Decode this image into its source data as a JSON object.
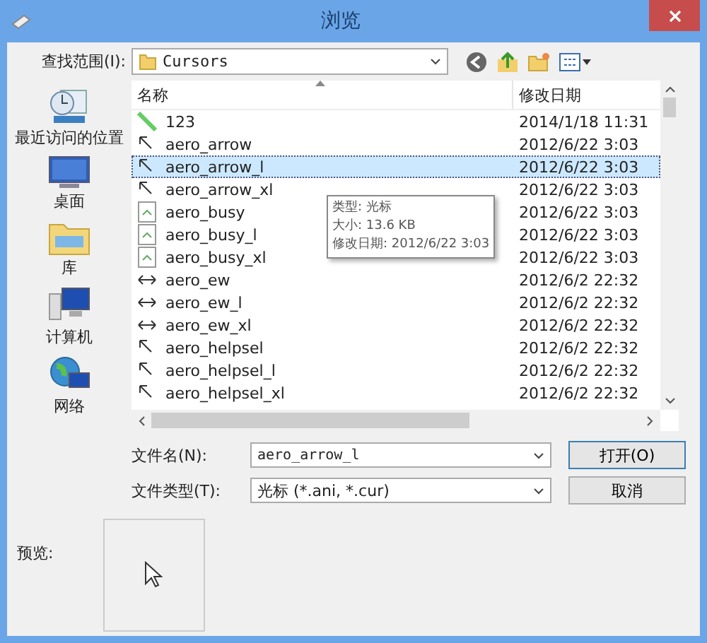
{
  "window": {
    "title": "浏览"
  },
  "location": {
    "label": "查找范围(I):",
    "value": "Cursors"
  },
  "sidebar": {
    "items": [
      {
        "label": "最近访问的位置",
        "kind": "recent"
      },
      {
        "label": "桌面",
        "kind": "desktop"
      },
      {
        "label": "库",
        "kind": "library"
      },
      {
        "label": "计算机",
        "kind": "computer"
      },
      {
        "label": "网络",
        "kind": "network"
      }
    ]
  },
  "table": {
    "columns": [
      "名称",
      "修改日期"
    ],
    "rows": [
      {
        "name": "123",
        "date": "2014/1/18 11:31",
        "kind": "green",
        "selected": false
      },
      {
        "name": "aero_arrow",
        "date": "2012/6/22 3:03",
        "kind": "arrow",
        "selected": false
      },
      {
        "name": "aero_arrow_l",
        "date": "2012/6/22 3:03",
        "kind": "arrow",
        "selected": true
      },
      {
        "name": "aero_arrow_xl",
        "date": "2012/6/22 3:03",
        "kind": "arrow",
        "selected": false
      },
      {
        "name": "aero_busy",
        "date": "2012/6/22 3:03",
        "kind": "doc",
        "selected": false
      },
      {
        "name": "aero_busy_l",
        "date": "2012/6/22 3:03",
        "kind": "doc",
        "selected": false
      },
      {
        "name": "aero_busy_xl",
        "date": "2012/6/22 3:03",
        "kind": "doc",
        "selected": false
      },
      {
        "name": "aero_ew",
        "date": "2012/6/2 22:32",
        "kind": "ew",
        "selected": false
      },
      {
        "name": "aero_ew_l",
        "date": "2012/6/2 22:32",
        "kind": "ew",
        "selected": false
      },
      {
        "name": "aero_ew_xl",
        "date": "2012/6/2 22:32",
        "kind": "ew",
        "selected": false
      },
      {
        "name": "aero_helpsel",
        "date": "2012/6/2 22:32",
        "kind": "arrow",
        "selected": false
      },
      {
        "name": "aero_helpsel_l",
        "date": "2012/6/2 22:32",
        "kind": "arrow",
        "selected": false
      },
      {
        "name": "aero_helpsel_xl",
        "date": "2012/6/2 22:32",
        "kind": "arrow",
        "selected": false
      }
    ]
  },
  "tooltip": [
    "类型: 光标",
    "大小: 13.6 KB",
    "修改日期: 2012/6/22 3:03"
  ],
  "filename": {
    "label": "文件名(N):",
    "value": "aero_arrow_l"
  },
  "filetype": {
    "label": "文件类型(T):",
    "value": "光标 (*.ani, *.cur)"
  },
  "buttons": [
    "打开(O)",
    "取消"
  ],
  "preview": {
    "label": "预览:"
  }
}
